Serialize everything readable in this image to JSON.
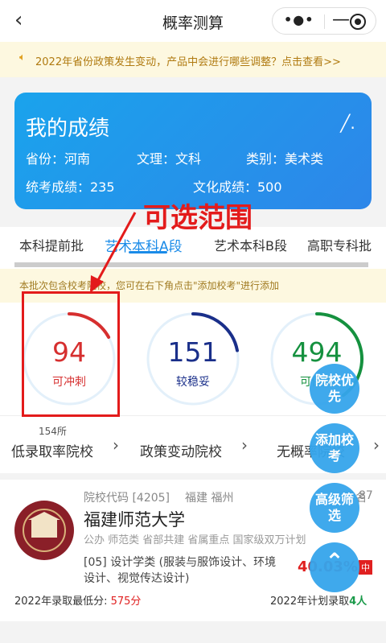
{
  "header": {
    "title": "概率测算",
    "back_icon": "chevron-left-icon",
    "more_icon": "more-dots-icon",
    "minimize_icon": "minimize-icon",
    "close_icon": "target-icon"
  },
  "notice": {
    "icon": "speaker-icon",
    "text": "2022年省份政策发生变动，产品中会进行哪些调整？点击查看>>"
  },
  "score_card": {
    "title": "我的成绩",
    "province_label": "省份：河南",
    "track_label": "文理：文科",
    "category_label": "类别：美术类",
    "exam_score_label": "统考成绩：235",
    "culture_score_label": "文化成绩：500",
    "edit_icon": "edit-pen-icon"
  },
  "annotation": {
    "text": "可选范围",
    "color": "#e31b1b"
  },
  "tabs": [
    {
      "label": "本科提前批"
    },
    {
      "label": "艺术本科A段",
      "active": true
    },
    {
      "label": "艺术本科B段"
    },
    {
      "label": "高职专科批"
    }
  ],
  "batch_note": {
    "text": "本批次包含校考院校，您可在右下角点击\"添加校考\"进行添加"
  },
  "stats": [
    {
      "value": "94",
      "label": "可冲刺",
      "color": "#d62f2f",
      "arc_fraction": 0.17
    },
    {
      "value": "151",
      "label": "较稳妥",
      "color": "#1a2f8a",
      "arc_fraction": 0.22
    },
    {
      "value": "494",
      "label": "可保底",
      "color": "#15913f",
      "arc_fraction": 0.4
    }
  ],
  "shortcuts": [
    {
      "count": "154所",
      "name": "低录取率院校"
    },
    {
      "count": "",
      "name": "政策变动院校"
    },
    {
      "count": "",
      "name": "无概率院校"
    }
  ],
  "school": {
    "code": "院校代码 [4205]",
    "location": "福建 福州",
    "rank_label": "排名",
    "rank_value": "87",
    "name": "福建师范大学",
    "tags": "公办  师范类  省部共建  省属重点  国家级双万计划",
    "major": "[05] 设计学类 (服装与服饰设计、环境",
    "major_line2": "设计、视觉传达设计)",
    "probability": "40.03%",
    "prob_tag": "中",
    "min_score_label": "2022年录取最低分: ",
    "min_score_value": "575分",
    "plan_label": "2022年计划录取",
    "plan_value": "4人"
  },
  "fabs": {
    "priority": "院校优先",
    "add_school": "添加校考",
    "advanced_filter": "高级筛选",
    "top_icon": "chevron-up-icon"
  }
}
